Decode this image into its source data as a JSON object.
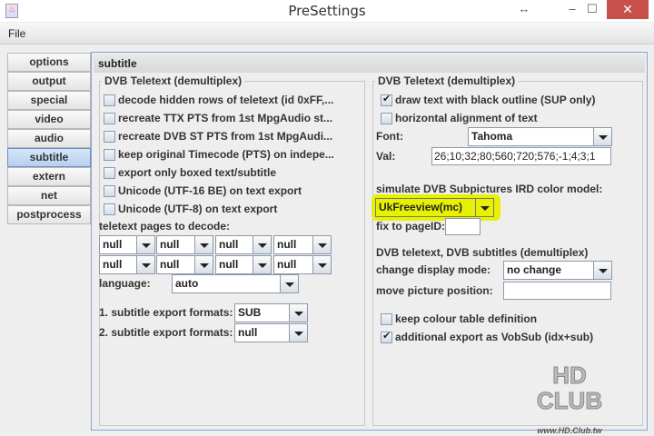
{
  "window": {
    "title": "PreSettings",
    "icon_symbol": "♨"
  },
  "menu": {
    "file": "File"
  },
  "tabs": [
    "options",
    "output",
    "special",
    "video",
    "audio",
    "subtitle",
    "extern",
    "net",
    "postprocess"
  ],
  "selected_tab": "subtitle",
  "panel": {
    "header": "subtitle"
  },
  "left": {
    "title": "DVB Teletext (demultiplex)",
    "checkboxes": [
      {
        "label": "decode hidden rows of teletext (id 0xFF,...",
        "checked": false
      },
      {
        "label": "recreate TTX PTS from 1st MpgAudio st...",
        "checked": false
      },
      {
        "label": "recreate DVB ST PTS from 1st MpgAudi...",
        "checked": false
      },
      {
        "label": "keep original Timecode (PTS) on indepe...",
        "checked": false
      },
      {
        "label": "export only boxed text/subtitle",
        "checked": false
      },
      {
        "label": "Unicode (UTF-16 BE) on text export",
        "checked": false
      },
      {
        "label": "Unicode (UTF-8) on text export",
        "checked": false
      }
    ],
    "pages_label": "teletext pages to decode:",
    "pages": [
      "null",
      "null",
      "null",
      "null",
      "null",
      "null",
      "null",
      "null"
    ],
    "language_label": "language:",
    "language": "auto",
    "export1_label": "1. subtitle export formats:",
    "export1": "SUB",
    "export2_label": "2. subtitle export formats:",
    "export2": "null"
  },
  "right": {
    "title": "DVB Teletext (demultiplex)",
    "cb_outline": {
      "label": "draw text with black outline (SUP only)",
      "checked": true
    },
    "cb_align": {
      "label": "horizontal alignment of text",
      "checked": false
    },
    "font_label": "Font:",
    "font": "Tahoma",
    "val_label": "Val:",
    "val": "26;10;32;80;560;720;576;-1;4;3;1",
    "simulate_label": "simulate DVB Subpictures IRD color model:",
    "color_model": "UkFreeview(mc)",
    "highlight_color": "#e8f200",
    "pageid_label": "fix to pageID:",
    "pageid": "",
    "section2": "DVB teletext, DVB subtitles (demultiplex)",
    "display_mode_label": "change display mode:",
    "display_mode": "no change",
    "move_label": "move picture position:",
    "move": "",
    "cb_keep": {
      "label": "keep colour table definition",
      "checked": false
    },
    "cb_vobsub": {
      "label": "additional export as VobSub (idx+sub)",
      "checked": true
    }
  },
  "watermark": {
    "text": "HD CLUB",
    "url": "www.HD.Club.tw"
  }
}
